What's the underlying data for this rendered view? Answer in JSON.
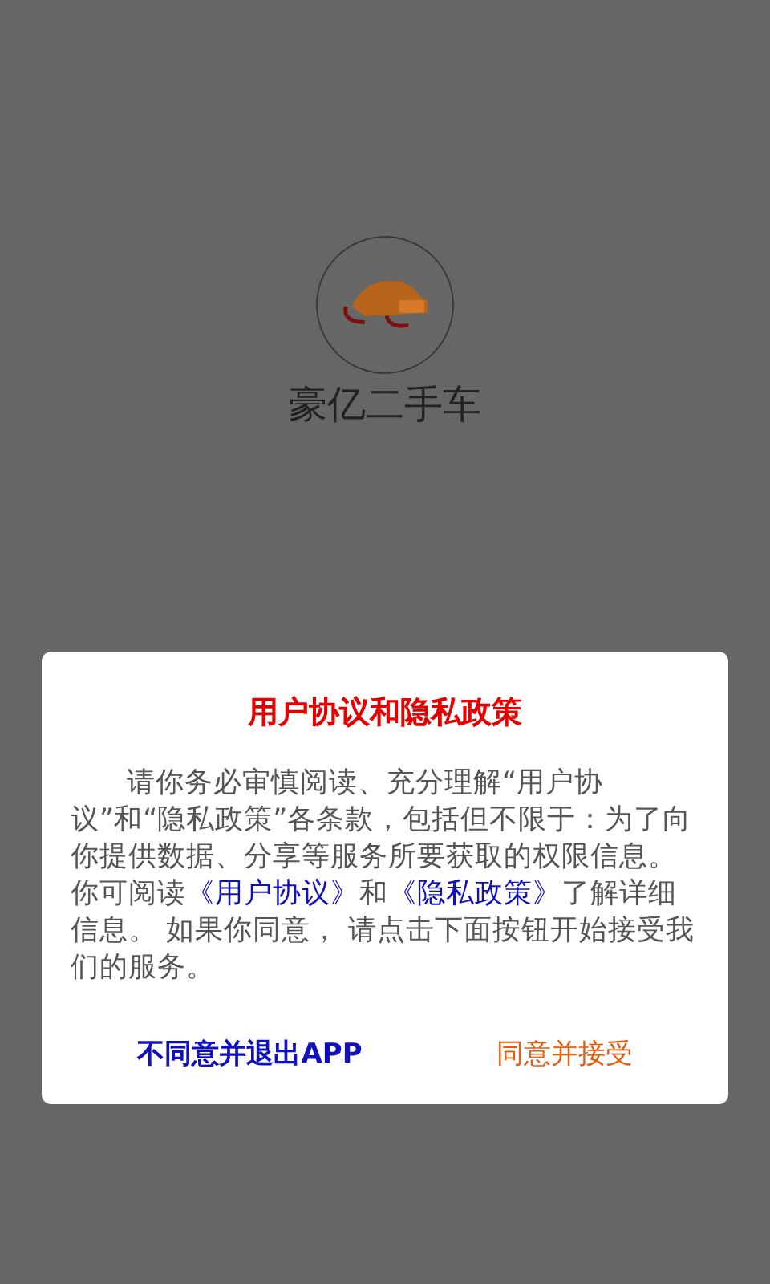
{
  "app": {
    "name": "豪亿二手车"
  },
  "dialog": {
    "title": "用户协议和隐私政策",
    "body": [
      {
        "kind": "text",
        "text": "请你务必审慎阅读、充分理解“用户协议”和“隐私政策”各条款，包括但不限于：为了向你提供数据、分享等服务所要获取的权限信息。你可阅读"
      },
      {
        "kind": "link",
        "text": "《用户协议》"
      },
      {
        "kind": "text",
        "text": "和"
      },
      {
        "kind": "link",
        "text": "《隐私政策》"
      },
      {
        "kind": "text",
        "text": "了解详细信息。  如果你同意， 请点击下面按钮开始接受我们的服务。"
      }
    ],
    "buttons": [
      {
        "kind": "decline",
        "label": "不同意并退出APP"
      },
      {
        "kind": "accept",
        "label": "同意并接受"
      }
    ]
  }
}
